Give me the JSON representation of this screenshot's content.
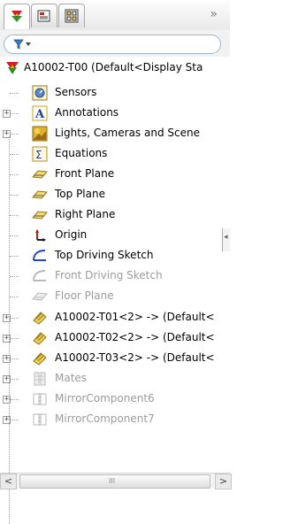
{
  "toolbar": {
    "more_label": "»"
  },
  "filter": {
    "icon": "funnel-icon"
  },
  "tree": {
    "root_label": "A10002-T00  (Default<Display Sta",
    "items": [
      {
        "label": "Sensors",
        "icon": "sensors-icon",
        "dim": false
      },
      {
        "label": "Annotations",
        "icon": "annotations-icon",
        "dim": false
      },
      {
        "label": "Lights, Cameras and Scene",
        "icon": "lights-icon",
        "dim": false
      },
      {
        "label": "Equations",
        "icon": "equations-icon",
        "dim": false
      },
      {
        "label": "Front Plane",
        "icon": "plane-icon",
        "dim": false
      },
      {
        "label": "Top Plane",
        "icon": "plane-icon",
        "dim": false
      },
      {
        "label": "Right Plane",
        "icon": "plane-icon",
        "dim": false
      },
      {
        "label": "Origin",
        "icon": "origin-icon",
        "dim": false
      },
      {
        "label": "Top Driving Sketch",
        "icon": "sketch-icon",
        "dim": false
      },
      {
        "label": "Front Driving Sketch",
        "icon": "sketch-icon",
        "dim": true
      },
      {
        "label": "Floor Plane",
        "icon": "plane-icon",
        "dim": true
      },
      {
        "label": "A10002-T01<2> -> (Default<",
        "icon": "part-icon",
        "dim": false
      },
      {
        "label": "A10002-T02<2> -> (Default<",
        "icon": "part-icon",
        "dim": false
      },
      {
        "label": "A10002-T03<2> -> (Default<",
        "icon": "part-icon",
        "dim": false
      },
      {
        "label": "Mates",
        "icon": "mates-icon",
        "dim": true
      },
      {
        "label": "MirrorComponent6",
        "icon": "mirror-component-icon",
        "dim": true
      },
      {
        "label": "MirrorComponent7",
        "icon": "mirror-component-icon",
        "dim": true
      }
    ]
  },
  "scrollbar": {
    "left_arrow": "<",
    "right_arrow": ">",
    "grip": "III"
  }
}
